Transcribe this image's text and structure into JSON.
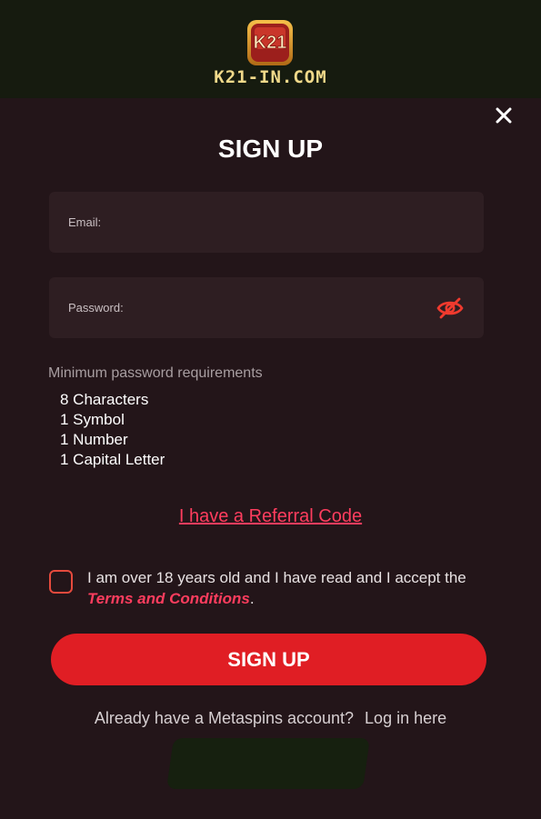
{
  "brand": {
    "logo_text": "K21",
    "site_name": "K21-IN.COM"
  },
  "modal": {
    "title": "SIGN UP",
    "close_icon": "close-icon"
  },
  "form": {
    "email_label": "Email:",
    "password_label": "Password:",
    "password_toggle_icon": "eye-off-icon"
  },
  "requirements": {
    "title": "Minimum password requirements",
    "items": [
      "8 Characters",
      "1 Symbol",
      "1 Number",
      "1 Capital Letter"
    ]
  },
  "referral": {
    "label": "I have a Referral Code"
  },
  "consent": {
    "text_before": "I am over 18 years old and I have read and I accept the ",
    "terms_link": "Terms and Conditions",
    "text_after": ".",
    "checked": false
  },
  "signup_button": {
    "label": "SIGN UP"
  },
  "footer": {
    "prompt": "Already have a Metaspins account?",
    "login_link": "Log in here"
  },
  "colors": {
    "background": "#231519",
    "header": "#161b0f",
    "field": "#2e1e22",
    "accent_red": "#e01e24",
    "link_pink": "#ff3d5e",
    "brand_gold": "#f0d98a"
  }
}
